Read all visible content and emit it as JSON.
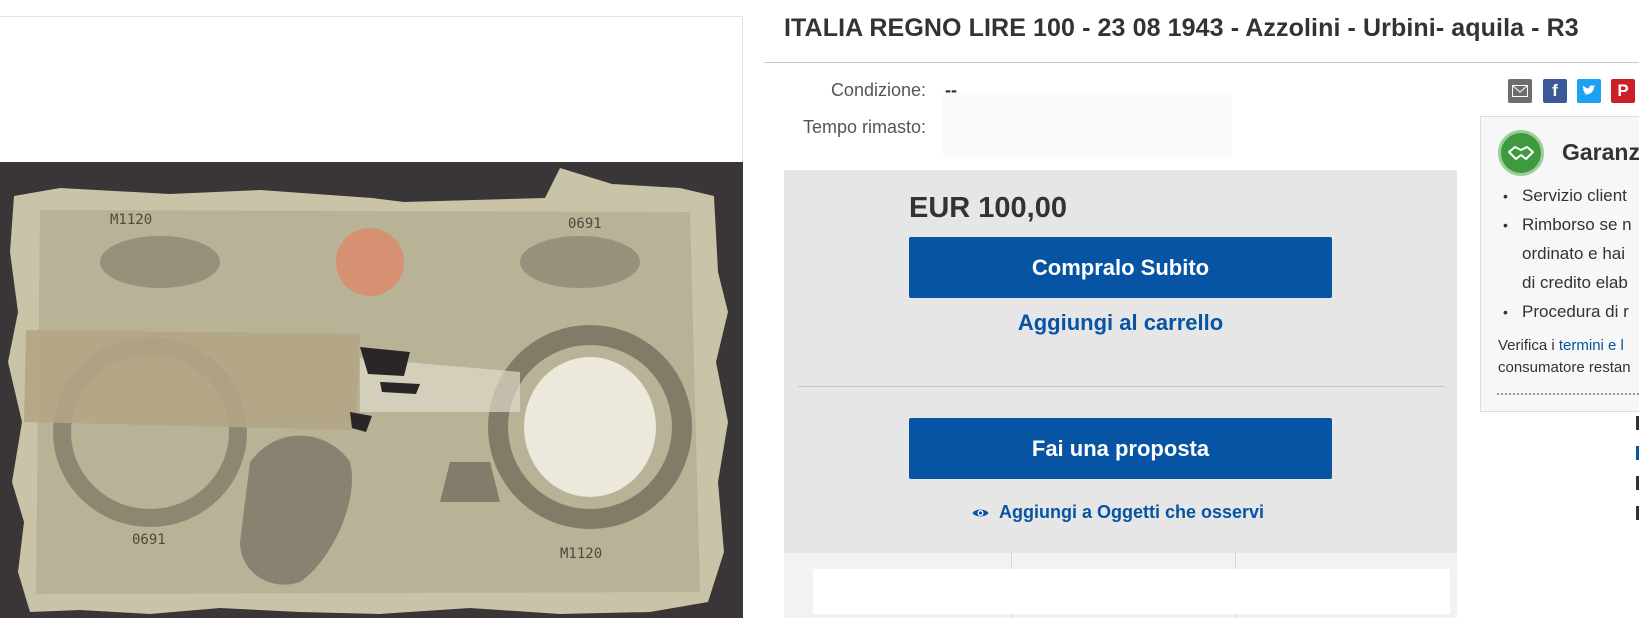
{
  "listing": {
    "title": "ITALIA REGNO LIRE 100 - 23 08 1943 - Azzolini - Urbini- aquila - R3",
    "condition_label": "Condizione:",
    "condition_value": "--",
    "time_left_label": "Tempo rimasto:"
  },
  "buy": {
    "price": "EUR 100,00",
    "buy_now_label": "Compralo Subito",
    "add_to_cart_label": "Aggiungi al carrello",
    "make_offer_label": "Fai una proposta",
    "watch_label": "Aggiungi a Oggetti che osservi"
  },
  "share": {
    "icons": [
      "mail-icon",
      "facebook-icon",
      "twitter-icon",
      "pinterest-icon"
    ]
  },
  "guarantee": {
    "title": "Garanz",
    "items": [
      [
        "Servizio client"
      ],
      [
        "Rimborso se n",
        "ordinato e hai",
        "di credito elab"
      ],
      [
        "Procedura di r"
      ]
    ],
    "note_prefix": "Verifica i ",
    "note_link": "termini e l",
    "note_line2": "consumatore restan"
  },
  "colors": {
    "primary_button": "#0654a3",
    "link": "#0654a3",
    "buybox_bg": "#e6e6e6",
    "guarantee_green": "#3e9a3e"
  }
}
